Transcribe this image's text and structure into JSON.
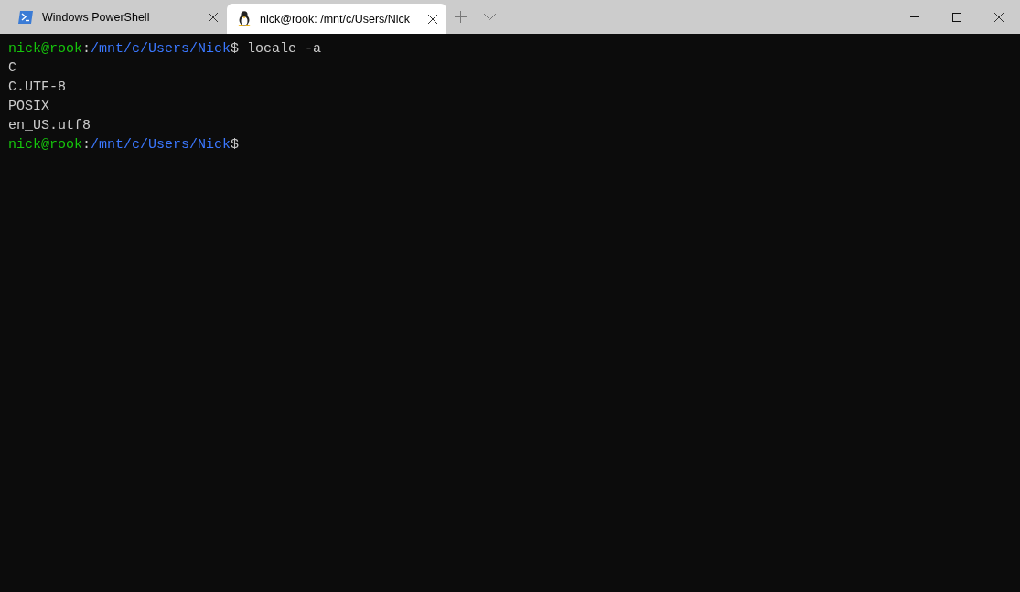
{
  "tabs": [
    {
      "kind": "powershell",
      "label": "Windows PowerShell",
      "selected": false
    },
    {
      "kind": "linux",
      "label": "nick@rook: /mnt/c/Users/Nick",
      "selected": true
    }
  ],
  "terminal": {
    "lines": [
      {
        "kind": "prompt",
        "user_host": "nick@rook",
        "colon": ":",
        "path": "/mnt/c/Users/Nick",
        "dollar": "$",
        "command": " locale -a"
      },
      {
        "kind": "output",
        "text": "C"
      },
      {
        "kind": "output",
        "text": "C.UTF-8"
      },
      {
        "kind": "output",
        "text": "POSIX"
      },
      {
        "kind": "output",
        "text": "en_US.utf8"
      },
      {
        "kind": "prompt",
        "user_host": "nick@rook",
        "colon": ":",
        "path": "/mnt/c/Users/Nick",
        "dollar": "$"
      }
    ]
  }
}
